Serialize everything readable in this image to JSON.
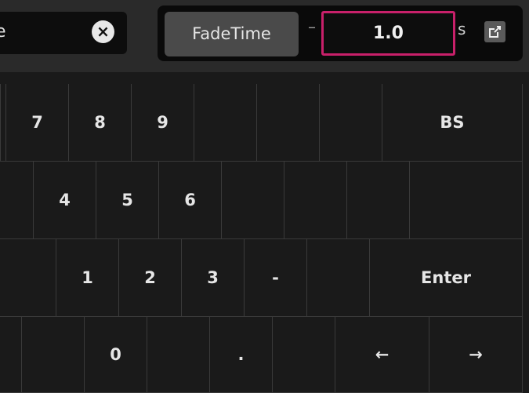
{
  "name_field": {
    "value": "e"
  },
  "clear_glyph": "×",
  "parameter": {
    "label": "FadeTime",
    "dash": "–",
    "value": "1.0",
    "unit": "s"
  },
  "keypad": {
    "row1": [
      "7",
      "8",
      "9",
      "",
      "",
      "",
      "BS"
    ],
    "row2": [
      "",
      "4",
      "5",
      "6",
      "",
      "",
      "",
      ""
    ],
    "row3": [
      "",
      "1",
      "2",
      "3",
      "-",
      "",
      "Enter"
    ],
    "row4": [
      "",
      "",
      "0",
      "",
      ".",
      "",
      "←",
      "→"
    ]
  }
}
